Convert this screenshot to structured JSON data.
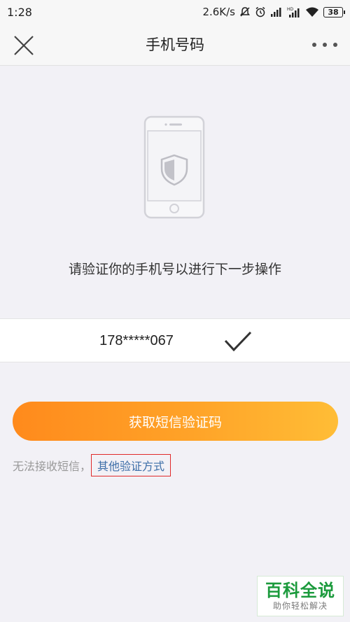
{
  "status_bar": {
    "time": "1:28",
    "network_speed": "2.6K/s",
    "battery": "38",
    "icons": [
      "mute-alarm-icon",
      "alarm-icon",
      "signal-icon",
      "hd-signal-icon",
      "wifi-icon",
      "battery-icon"
    ]
  },
  "nav": {
    "title": "手机号码",
    "close_icon": "close-icon",
    "more_icon": "more-icon"
  },
  "illustration": {
    "icon": "phone-shield-icon"
  },
  "prompt": "请验证你的手机号以进行下一步操作",
  "phone": {
    "number": "178*****067",
    "check_icon": "check-icon"
  },
  "button": {
    "label": "获取短信验证码"
  },
  "alternative": {
    "prefix": "无法接收短信，",
    "link": "其他验证方式"
  },
  "watermark": {
    "title": "百科全说",
    "subtitle": "助你轻松解决"
  },
  "colors": {
    "accent_start": "#ff8a1c",
    "accent_end": "#ffbd36",
    "link": "#3d6ea8",
    "highlight_border": "#e02a2a",
    "watermark_green": "#1b9a3c"
  }
}
